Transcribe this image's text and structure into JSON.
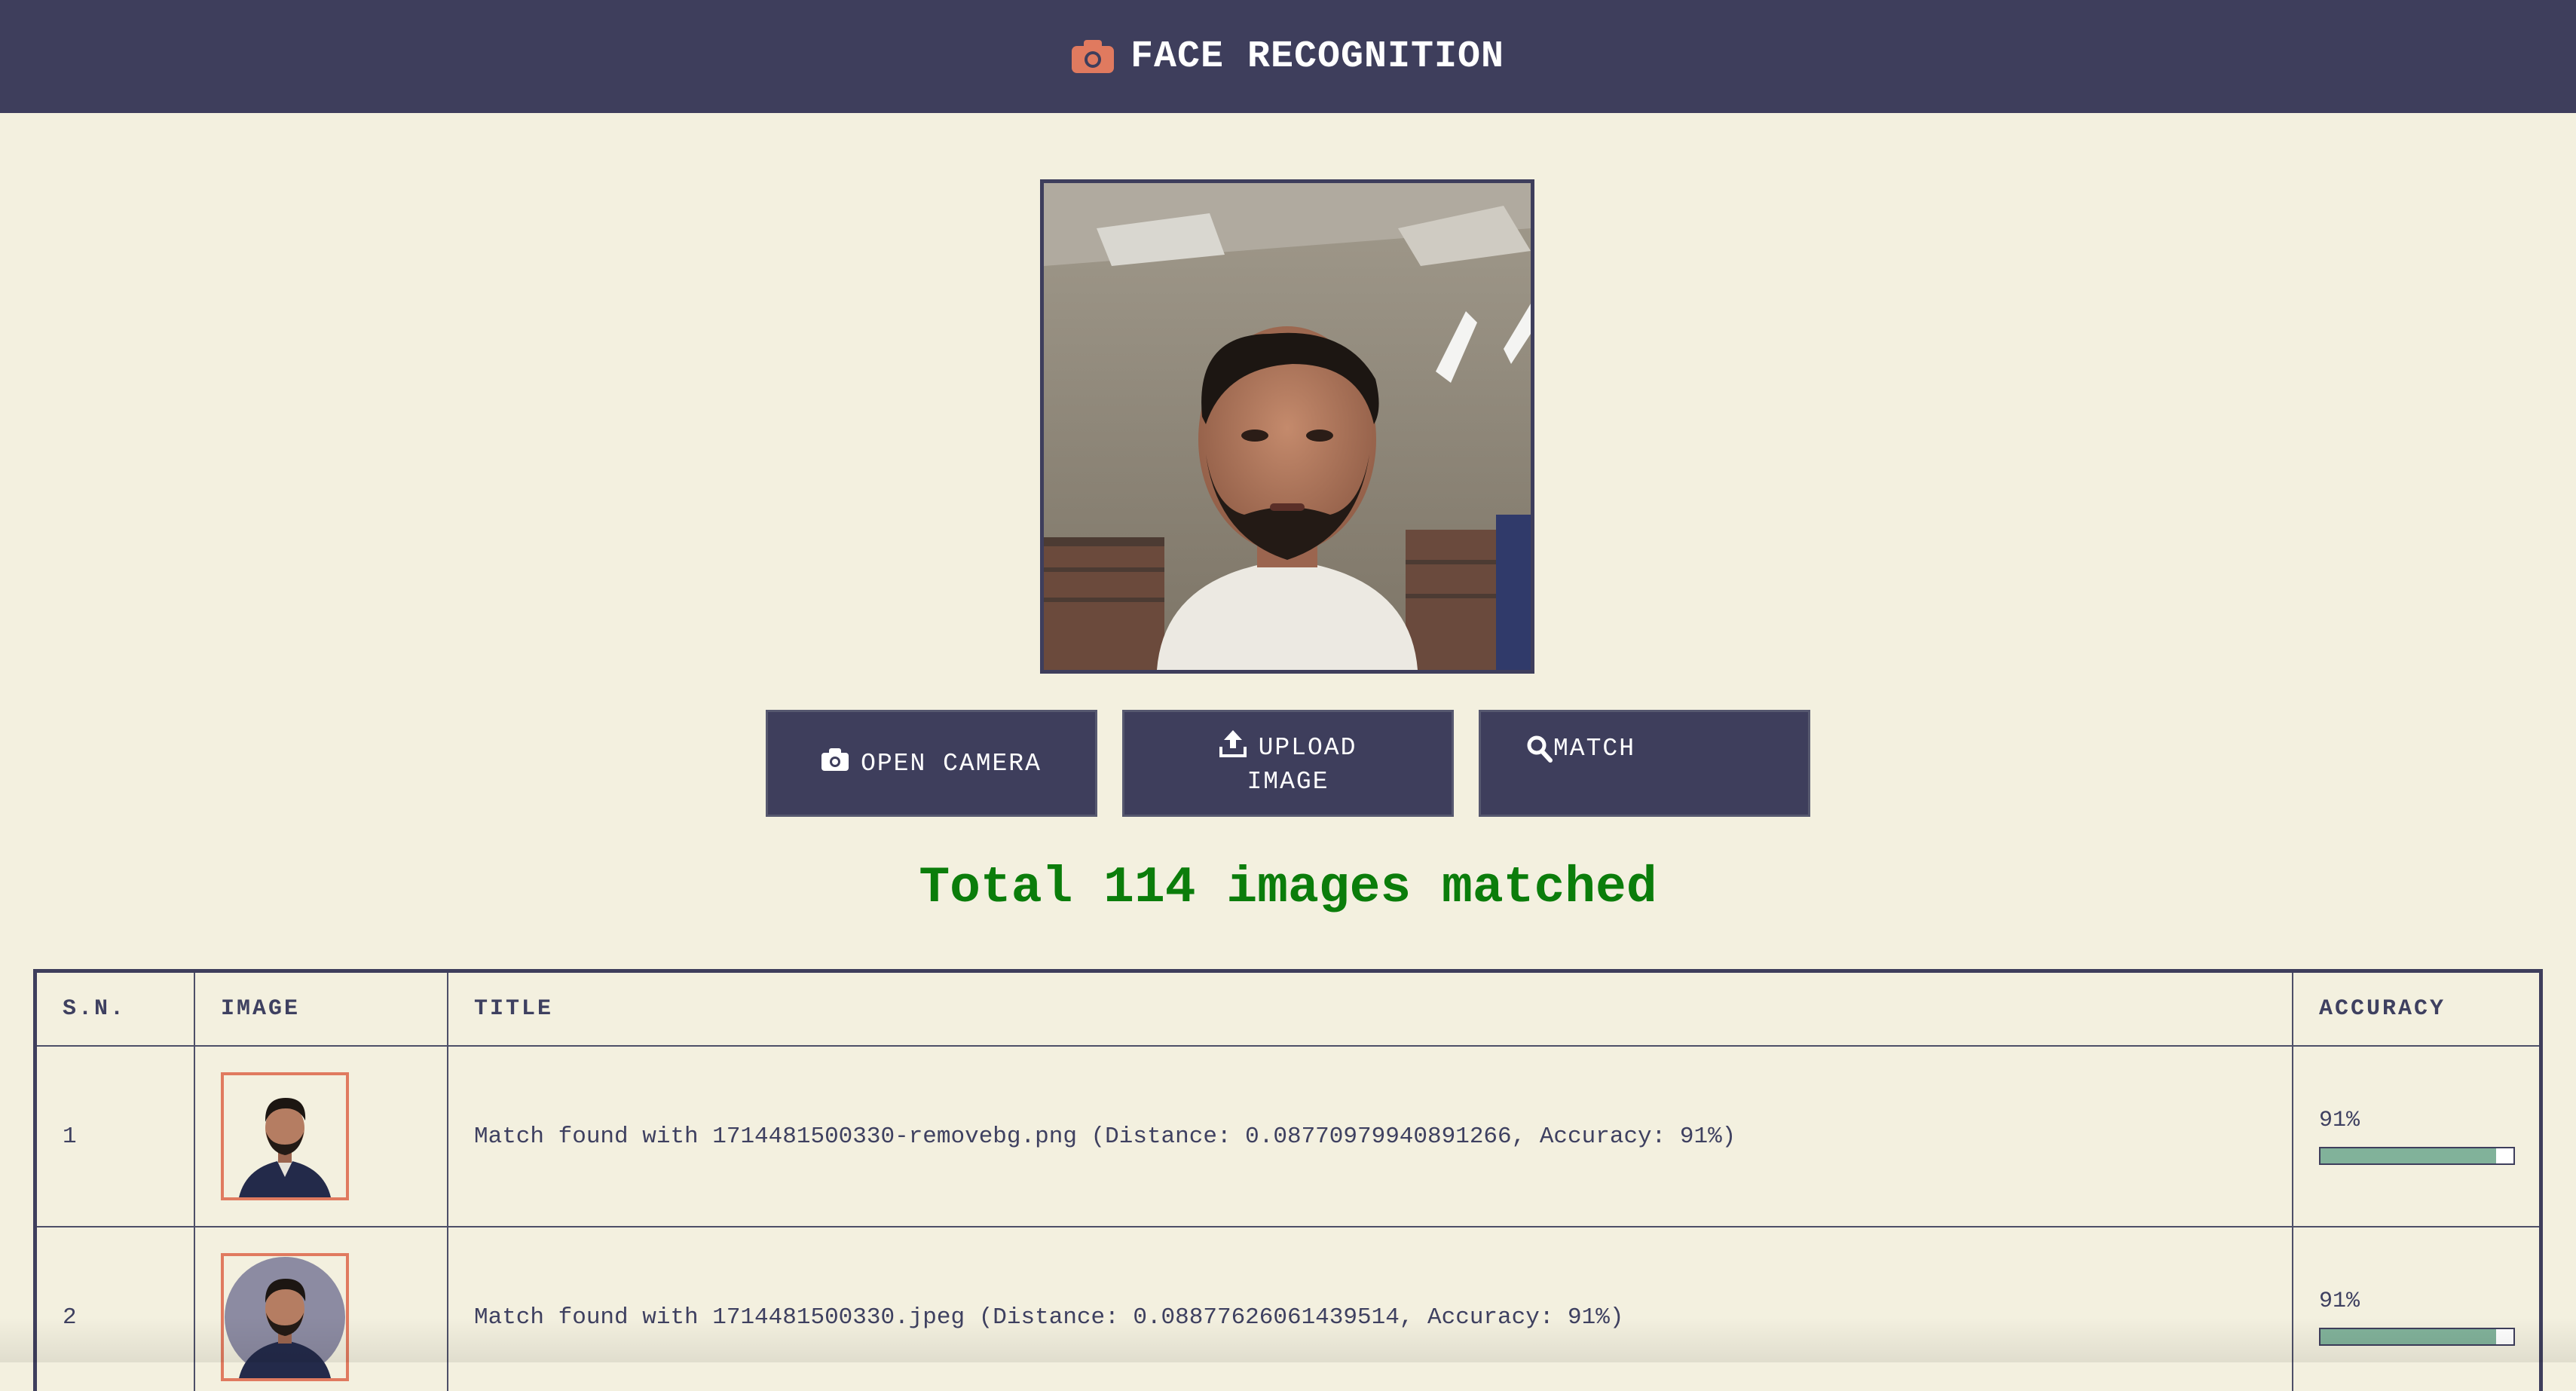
{
  "header": {
    "title": "FACE RECOGNITION",
    "icon": "camera-icon"
  },
  "buttons": {
    "open_camera": "OPEN CAMERA",
    "upload_line1": "UPLOAD",
    "upload_line2": "IMAGE",
    "match": "MATCH"
  },
  "result": {
    "summary": "Total 114 images matched"
  },
  "table": {
    "headers": [
      "S.N.",
      "IMAGE",
      "TITLE",
      "ACCURACY"
    ],
    "rows": [
      {
        "sn": "1",
        "title": "Match found with 1714481500330-removebg.png (Distance: 0.08770979940891266, Accuracy: 91%)",
        "accuracy_label": "91%",
        "accuracy": 0.91
      },
      {
        "sn": "2",
        "title": "Match found with 1714481500330.jpeg (Distance: 0.08877626061439514, Accuracy: 91%)",
        "accuracy_label": "91%",
        "accuracy": 0.91
      }
    ]
  },
  "colors": {
    "header_bg": "#3e3e5c",
    "page_bg": "#f3f0df",
    "accent": "#e07a5f",
    "success": "#0b7d0b",
    "bar_fill": "#81b29a"
  }
}
